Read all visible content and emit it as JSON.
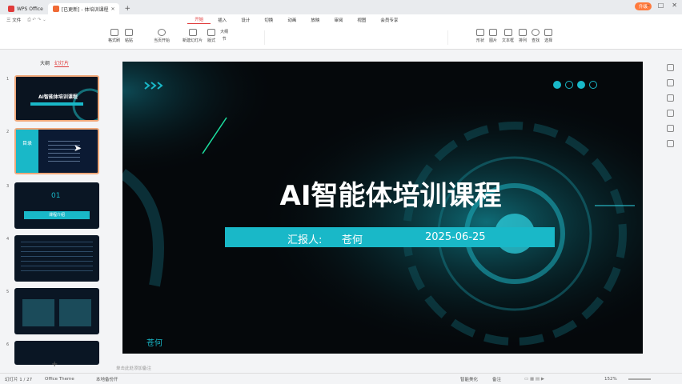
{
  "tabs": [
    {
      "label": "WPS Office"
    },
    {
      "label": "[已更新] - 体培训课程"
    }
  ],
  "pill": "升级",
  "quick": {
    "file": "三 文件"
  },
  "menu": [
    "开始",
    "插入",
    "设计",
    "切换",
    "动画",
    "放映",
    "审阅",
    "视图",
    "会员专享"
  ],
  "ribbon": {
    "format_painter": "格式刷",
    "paste": "粘贴",
    "start_from_current": "当页开始",
    "new_slide": "新建幻灯片",
    "layout": "版式",
    "section": "节",
    "outline": "大纲",
    "shape": "形状",
    "picture": "图片",
    "textbox": "文本框",
    "arrange": "排列",
    "find": "查找",
    "replace": "替换",
    "select": "选择"
  },
  "left": {
    "tab1": "大纲",
    "tab2": "幻灯片"
  },
  "slides": [
    {
      "num": "1",
      "title": "AI智能体培训课程"
    },
    {
      "num": "2",
      "title": "目录"
    },
    {
      "num": "3",
      "title": "01",
      "sub": "课程介绍"
    },
    {
      "num": "4"
    },
    {
      "num": "5"
    },
    {
      "num": "6"
    }
  ],
  "slide": {
    "title": "AI智能体培训课程",
    "presenter_label": "汇报人:",
    "presenter": "苍何",
    "date": "2025-06-25",
    "footer": "苍何"
  },
  "note": "单击此处添加备注",
  "status": {
    "page": "幻灯片 1 / 27",
    "theme": "Office Theme",
    "font": "本地备份开",
    "review": "智能美化",
    "comment": "备注",
    "zoom": "152%"
  },
  "colors": {
    "accent": "#19b8c8",
    "bg": "#05080b"
  }
}
